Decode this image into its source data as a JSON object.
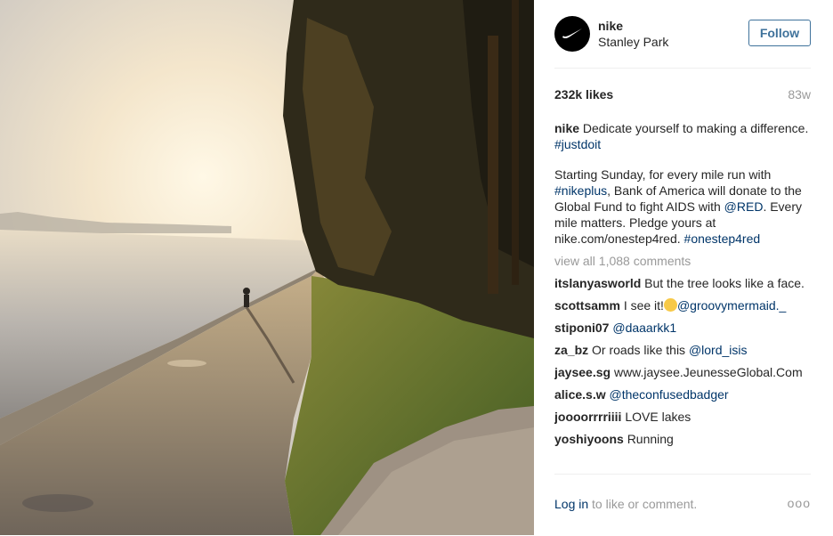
{
  "post": {
    "username": "nike",
    "location": "Stanley Park",
    "follow_label": "Follow",
    "likes": "232k likes",
    "time_ago": "83w",
    "caption": {
      "user": "nike",
      "text": "Dedicate yourself to making a difference.",
      "hashtag": "#justdoit",
      "p2_a": "Starting Sunday, for every mile run with",
      "p2_tag1": "#nikeplus",
      "p2_b": ", Bank of America will donate to the Global Fund to fight AIDS with",
      "p2_mention": "@RED",
      "p2_c": ". Every mile matters. Pledge yours at nike.com/onestep4red.",
      "p2_tag2": "#onestep4red"
    },
    "view_all": "view all 1,088 comments",
    "comments": [
      {
        "user": "itslanyasworld",
        "text": "But the tree looks like a face."
      },
      {
        "user": "scottsamm",
        "text": "I see it!",
        "mention": "@groovymermaid._"
      },
      {
        "user": "stiponi07",
        "mention": "@daaarkk1"
      },
      {
        "user": "za_bz",
        "text": "Or roads like this",
        "mention": "@lord_isis"
      },
      {
        "user": "jaysee.sg",
        "text": "www.jaysee.JeunesseGlobal.Com"
      },
      {
        "user": "alice.s.w",
        "mention": "@theconfusedbadger"
      },
      {
        "user": "joooorrrriiii",
        "text": "LOVE lakes"
      },
      {
        "user": "yoshiyoons",
        "text": "Running"
      }
    ],
    "footer": {
      "login": "Log in",
      "rest": "to like or comment.",
      "more": "ooo"
    }
  },
  "colors": {
    "link": "#003569",
    "follow": "#3f729b",
    "muted": "#999999"
  },
  "icons": {
    "avatar": "nike-swoosh-icon",
    "more": "more-options-icon",
    "emoji": "laughing-emoji-icon"
  }
}
